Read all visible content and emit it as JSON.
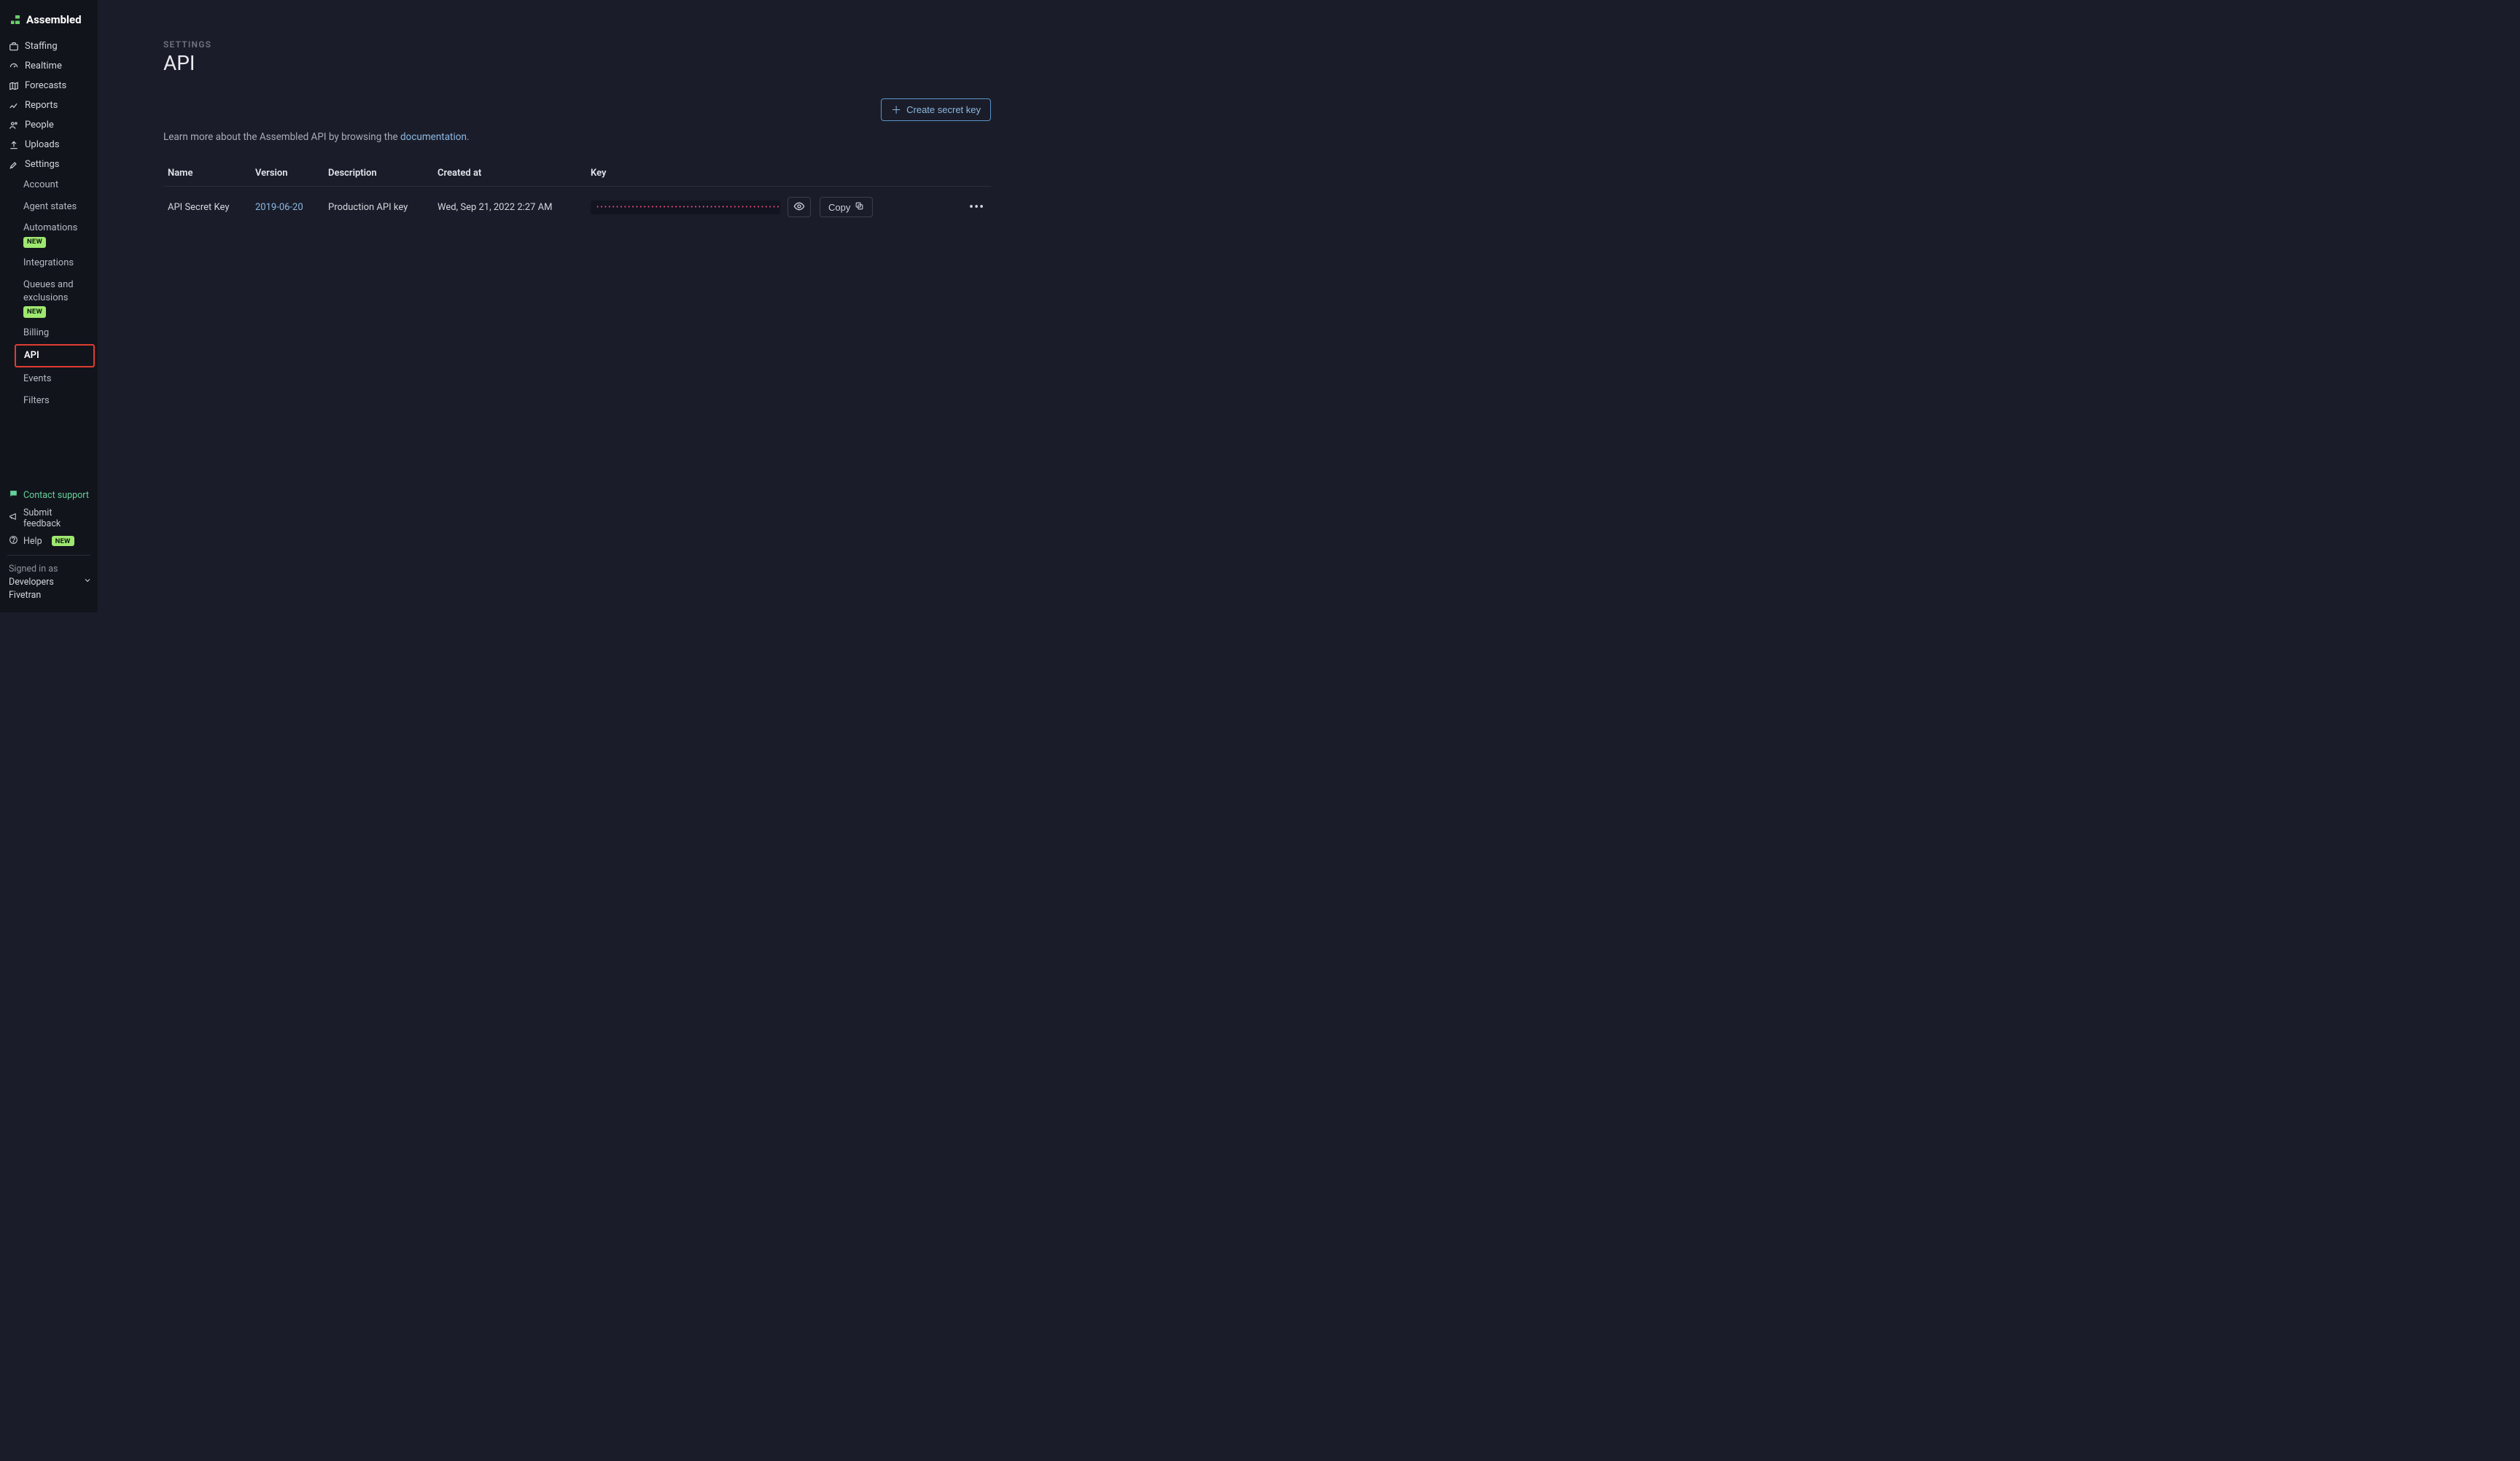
{
  "app": {
    "name": "Assembled"
  },
  "sidebar": {
    "items": [
      {
        "label": "Staffing",
        "icon": "briefcase-icon"
      },
      {
        "label": "Realtime",
        "icon": "gauge-icon"
      },
      {
        "label": "Forecasts",
        "icon": "map-icon"
      },
      {
        "label": "Reports",
        "icon": "chart-line-icon"
      },
      {
        "label": "People",
        "icon": "people-icon"
      },
      {
        "label": "Uploads",
        "icon": "upload-icon"
      },
      {
        "label": "Settings",
        "icon": "tools-icon"
      }
    ],
    "sub": [
      {
        "label": "Account"
      },
      {
        "label": "Agent states"
      },
      {
        "label": "Automations",
        "badge": "NEW"
      },
      {
        "label": "Integrations"
      },
      {
        "label": "Queues and exclusions",
        "badge": "NEW"
      },
      {
        "label": "Billing"
      },
      {
        "label": "API",
        "active": true
      },
      {
        "label": "Events"
      },
      {
        "label": "Filters"
      }
    ],
    "footer": {
      "support": "Contact support",
      "feedback": "Submit feedback",
      "help": "Help",
      "help_badge": "NEW",
      "signed_label": "Signed in as",
      "signed_line1": "Developers",
      "signed_line2": "Fivetran"
    }
  },
  "header": {
    "eyebrow": "SETTINGS",
    "title": "API",
    "create_label": "Create secret key"
  },
  "intro": {
    "prefix": "Learn more about the Assembled API by browsing the ",
    "link": "documentation",
    "suffix": "."
  },
  "table": {
    "headers": {
      "name": "Name",
      "version": "Version",
      "description": "Description",
      "created": "Created at",
      "key": "Key"
    },
    "rows": [
      {
        "name": "API Secret Key",
        "version": "2019-06-20",
        "description": "Production API key",
        "created": "Wed, Sep 21, 2022 2:27 AM",
        "key_masked": "••••••••••••••••••••••••••••••••••••••••••••••••",
        "copy_label": "Copy"
      }
    ]
  }
}
